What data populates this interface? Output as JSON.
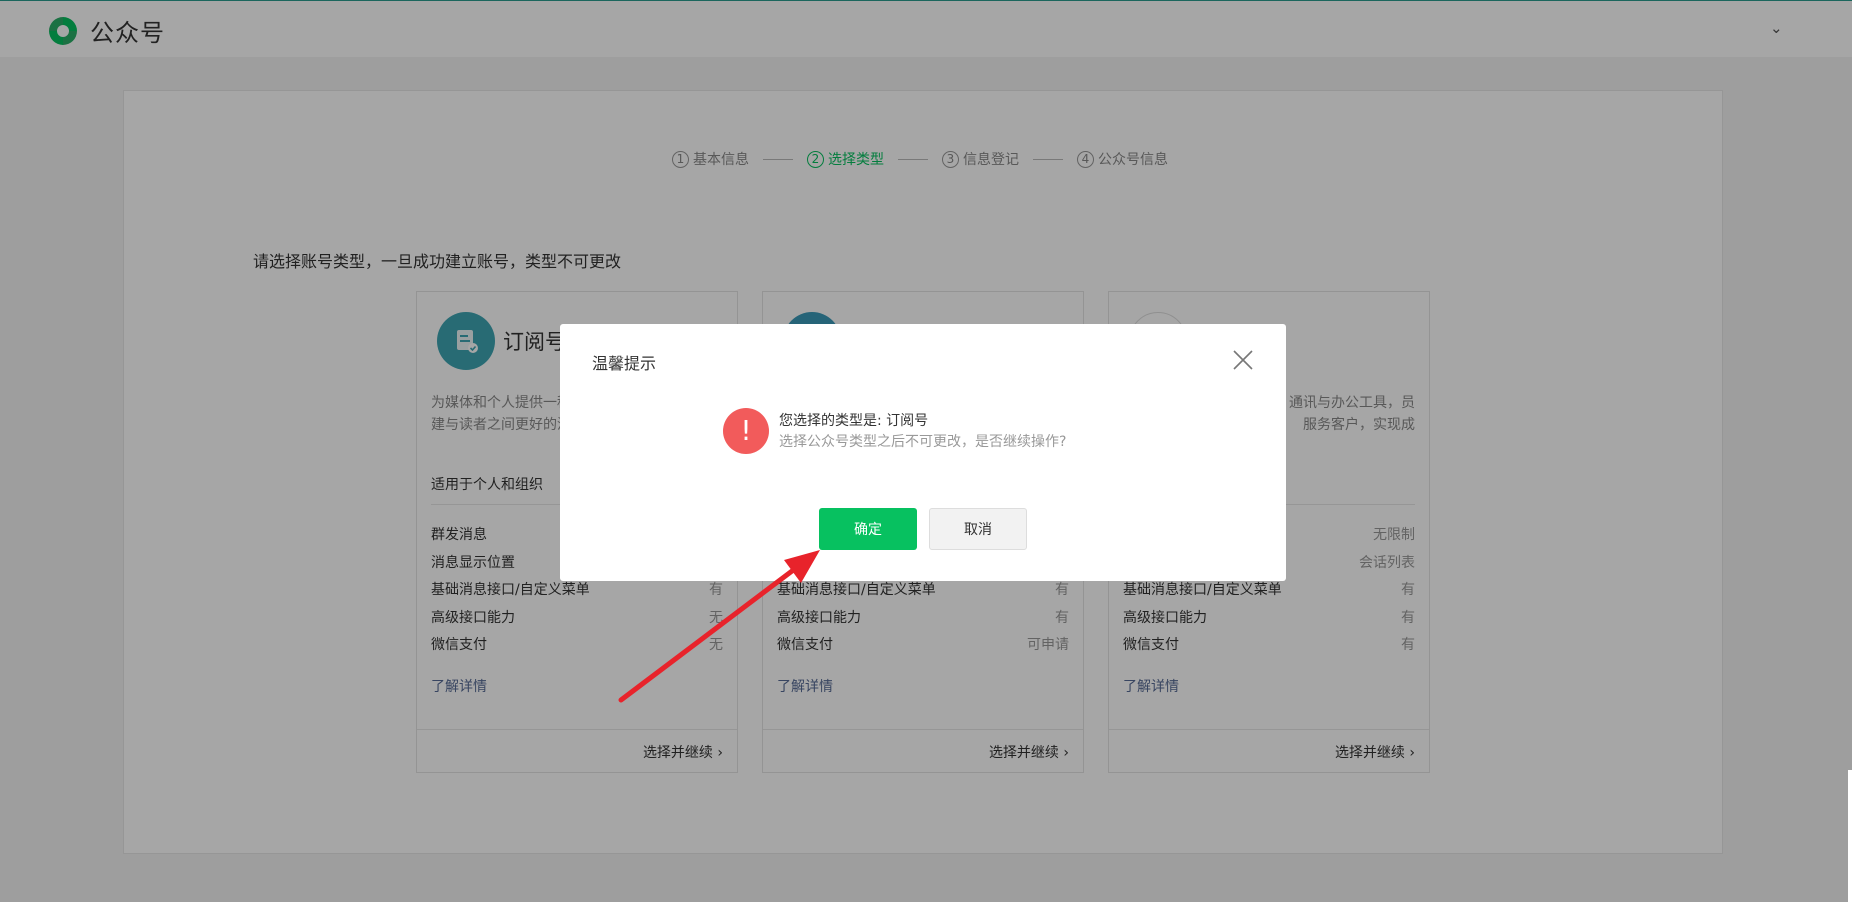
{
  "header": {
    "app_name": "公众号",
    "user_menu_icon": "chevron-down-icon"
  },
  "steps": [
    {
      "num": "1",
      "label": "基本信息"
    },
    {
      "num": "2",
      "label": "选择类型",
      "active": true
    },
    {
      "num": "3",
      "label": "信息登记"
    },
    {
      "num": "4",
      "label": "公众号信息"
    }
  ],
  "intro": "请选择账号类型，一旦成功建立账号，类型不可更改",
  "cards": [
    {
      "title": "订阅号",
      "desc_line1": "为媒体和个人提供一种",
      "desc_line2": "建与读者之间更好的沟",
      "suit": "适用于个人和组织",
      "features": [
        {
          "k": "群发消息",
          "v": ""
        },
        {
          "k": "消息显示位置",
          "v": ""
        },
        {
          "k": "基础消息接口/自定义菜单",
          "v": "有"
        },
        {
          "k": "高级接口能力",
          "v": "无"
        },
        {
          "k": "微信支付",
          "v": "无"
        }
      ],
      "more": "了解详情",
      "choose": "选择并继续"
    },
    {
      "title": "",
      "desc_line1": "",
      "desc_line2": "",
      "suit": "",
      "features": [
        {
          "k": "",
          "v": ""
        },
        {
          "k": "",
          "v": ""
        },
        {
          "k": "基础消息接口/自定义菜单",
          "v": "有"
        },
        {
          "k": "高级接口能力",
          "v": "有"
        },
        {
          "k": "微信支付",
          "v": "可申请"
        }
      ],
      "more": "了解详情",
      "choose": "选择并继续"
    },
    {
      "title": "",
      "desc_line1": "通讯与办公工具，员",
      "desc_line2": "服务客户，实现成",
      "suit": "",
      "features": [
        {
          "k": "",
          "v": "无限制"
        },
        {
          "k": "",
          "v": "会话列表"
        },
        {
          "k": "基础消息接口/自定义菜单",
          "v": "有"
        },
        {
          "k": "高级接口能力",
          "v": "有"
        },
        {
          "k": "微信支付",
          "v": "有"
        }
      ],
      "more": "了解详情",
      "choose": "选择并继续"
    }
  ],
  "dialog": {
    "title": "温馨提示",
    "warning_symbol": "!",
    "message": "您选择的类型是: 订阅号",
    "sub_message": "选择公众号类型之后不可更改，是否继续操作?",
    "confirm_label": "确定",
    "cancel_label": "取消"
  },
  "colors": {
    "brand_green": "#07c160",
    "warning_red": "#f25b5b",
    "annotation_arrow": "#e8232b",
    "link_blue": "#576b95"
  }
}
